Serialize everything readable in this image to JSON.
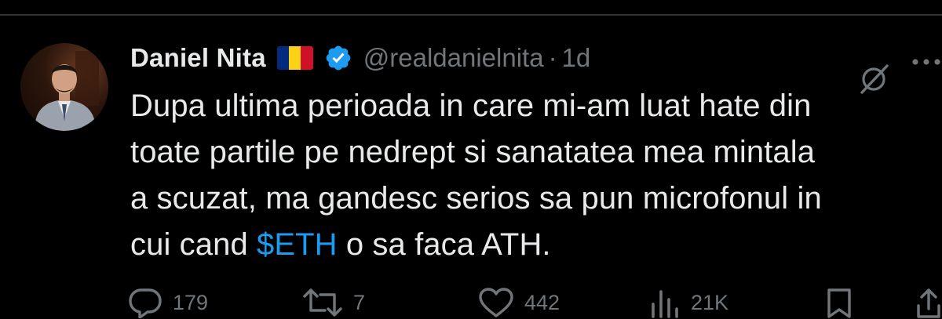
{
  "tweet": {
    "author_name": "Daniel Nita",
    "flag": "Romania",
    "verified": true,
    "handle": "@realdanielnita",
    "separator": "·",
    "time": "1d",
    "text_lines": [
      "Dupa ultima perioada in care mi-am luat hate din",
      "toate partile pe nedrept si sanatatea mea mintala",
      "a scuzat, ma gandesc serios sa pun microfonul in"
    ],
    "last_line_before": "cui cand ",
    "cashtag": "$ETH",
    "last_line_after": " o sa faca ATH."
  },
  "actions": {
    "replies": "179",
    "reposts": "7",
    "likes": "442",
    "views": "21K"
  },
  "icons": {
    "grok": "grok-icon",
    "more": "more-icon",
    "reply": "reply-icon",
    "repost": "repost-icon",
    "like": "like-icon",
    "views": "views-icon",
    "bookmark": "bookmark-icon",
    "share": "share-icon",
    "verified": "verified-badge-icon"
  },
  "colors": {
    "background": "#000000",
    "text": "#e7e9ea",
    "muted": "#71767b",
    "link": "#1d9bf0",
    "verified": "#1d9bf0",
    "flag_blue": "#002b7f",
    "flag_yellow": "#fcd116",
    "flag_red": "#ce1126"
  }
}
